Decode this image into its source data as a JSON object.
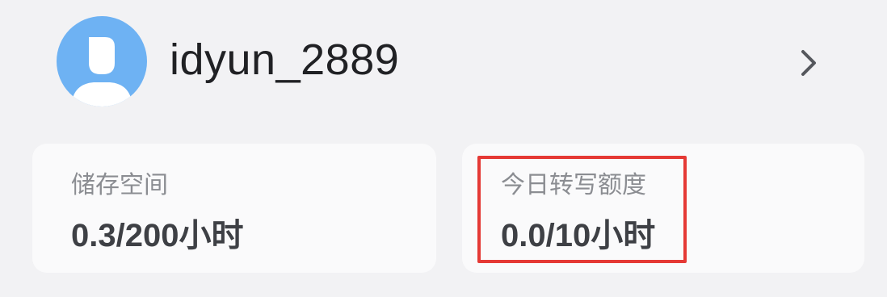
{
  "profile": {
    "username": "idyun_2889",
    "avatar_icon": "user-avatar-icon",
    "avatar_color": "#6eb2f3",
    "chevron_icon": "chevron-right-icon"
  },
  "cards": {
    "storage": {
      "label": "储存空间",
      "value": "0.3/200小时"
    },
    "daily_quota": {
      "label": "今日转写额度",
      "value": "0.0/10小时",
      "highlight_color": "#e53935"
    }
  }
}
